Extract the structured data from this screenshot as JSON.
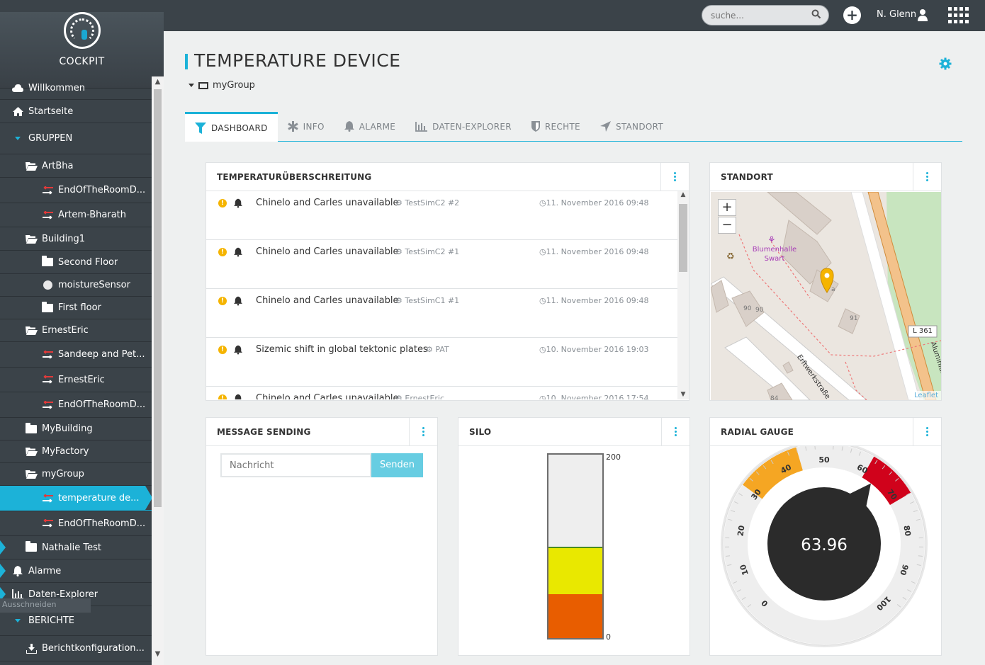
{
  "app": {
    "name": "COCKPIT"
  },
  "sidebar": {
    "items": [
      {
        "label": "Willkommen",
        "icon": "cloud-icon"
      },
      {
        "label": "Startseite",
        "icon": "home-icon"
      },
      {
        "label": "GRUPPEN",
        "icon": "caret-down-icon"
      },
      {
        "label": "ArtBha",
        "icon": "folder-open-icon"
      },
      {
        "label": "EndOfTheRoomD...",
        "icon": "device-icon"
      },
      {
        "label": "Artem-Bharath",
        "icon": "device-icon"
      },
      {
        "label": "Building1",
        "icon": "folder-open-icon"
      },
      {
        "label": "Second Floor",
        "icon": "folder-icon"
      },
      {
        "label": "moistureSensor",
        "icon": "circle-icon"
      },
      {
        "label": "First floor",
        "icon": "folder-icon"
      },
      {
        "label": "ErnestEric",
        "icon": "folder-open-icon"
      },
      {
        "label": "Sandeep and Pet...",
        "icon": "device-icon"
      },
      {
        "label": "ErnestEric",
        "icon": "device-icon"
      },
      {
        "label": "EndOfTheRoomD...",
        "icon": "device-icon"
      },
      {
        "label": "MyBuilding",
        "icon": "folder-icon"
      },
      {
        "label": "MyFactory",
        "icon": "folder-open-icon"
      },
      {
        "label": "myGroup",
        "icon": "folder-open-icon"
      },
      {
        "label": "temperature de...",
        "icon": "device-icon"
      },
      {
        "label": "EndOfTheRoomD...",
        "icon": "device-icon"
      },
      {
        "label": "Nathalie Test",
        "icon": "folder-icon"
      },
      {
        "label": "Alarme",
        "icon": "bell-icon"
      },
      {
        "label": "Daten-Explorer",
        "icon": "chart-icon"
      },
      {
        "label": "BERICHTE",
        "icon": "caret-down-icon"
      },
      {
        "label": "Berichtkonfiguration...",
        "icon": "download-icon"
      }
    ],
    "tooltip": "Ausschneiden"
  },
  "topbar": {
    "search_placeholder": "suche...",
    "user_name": "N. Glenn"
  },
  "page": {
    "title": "TEMPERATURE DEVICE",
    "breadcrumb": "myGroup"
  },
  "tabs": [
    {
      "label": "DASHBOARD",
      "icon": "filter-icon"
    },
    {
      "label": "INFO",
      "icon": "asterisk-icon"
    },
    {
      "label": "ALARME",
      "icon": "bell-icon"
    },
    {
      "label": "DATEN-EXPLORER",
      "icon": "chart-icon"
    },
    {
      "label": "RECHTE",
      "icon": "shield-icon"
    },
    {
      "label": "STANDORT",
      "icon": "location-arrow-icon"
    }
  ],
  "alarms_widget": {
    "title": "TEMPERATURÜBERSCHREITUNG",
    "rows": [
      {
        "text": "Chinelo and Carles unavailable",
        "source": "TestSimC2 #2",
        "time": "11. November 2016 09:48"
      },
      {
        "text": "Chinelo and Carles unavailable",
        "source": "TestSimC2 #1",
        "time": "11. November 2016 09:48"
      },
      {
        "text": "Chinelo and Carles unavailable",
        "source": "TestSimC1 #1",
        "time": "11. November 2016 09:48"
      },
      {
        "text": "Sizemic shift in global tektonic plates.",
        "source": "PAT",
        "time": "10. November 2016 19:03"
      },
      {
        "text": "Chinelo and Carles unavailable",
        "source": "ErnestEric",
        "time": "10. November 2016 17:54"
      }
    ]
  },
  "map_widget": {
    "title": "STANDORT",
    "zoom_in": "+",
    "zoom_out": "−",
    "poi": "Blumenhalle Swart",
    "street": "Erftwerkstraße",
    "road_badge": "L 361",
    "street2": "Aluminium...",
    "house_numbers": [
      "90",
      "90",
      "91",
      "84",
      "a"
    ],
    "attribution": "Leaflet"
  },
  "message_widget": {
    "title": "MESSAGE SENDING",
    "placeholder": "Nachricht",
    "send_label": "Senden"
  },
  "silo_widget": {
    "title": "SILO",
    "max_label": "200",
    "min_label": "0",
    "max": 200,
    "level": 100,
    "colors": {
      "low": "#e85d00",
      "mid": "#e9e800",
      "empty": "#eeeeee"
    }
  },
  "gauge_widget": {
    "title": "RADIAL GAUGE",
    "value": "63.96",
    "ticks": [
      "0",
      "10",
      "20",
      "30",
      "40",
      "50",
      "60",
      "70",
      "80",
      "90",
      "100"
    ],
    "colors": {
      "warning": "#f5a623",
      "critical": "#d0021b",
      "center": "#2b2b2b"
    }
  }
}
